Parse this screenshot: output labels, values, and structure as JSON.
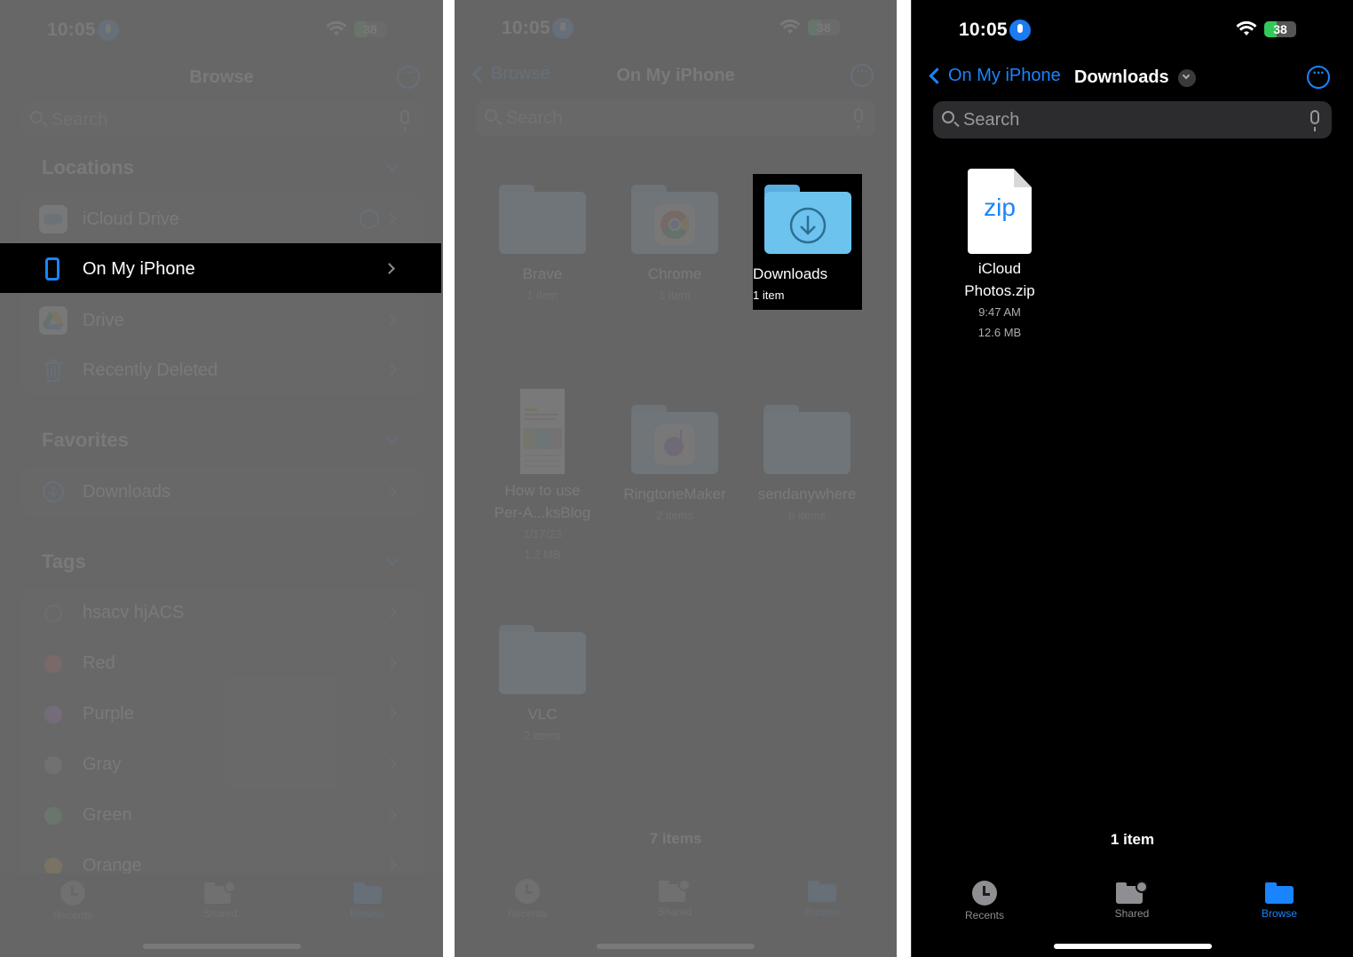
{
  "status_bar": {
    "time": "10:05",
    "battery_percent": "38",
    "battery_level": 0.38,
    "charging": true
  },
  "panel_browse": {
    "title": "Browse",
    "search_placeholder": "Search",
    "sections": {
      "locations": {
        "title": "Locations",
        "items": [
          {
            "label": "iCloud Drive",
            "icon": "icloud-icon",
            "loading": true
          },
          {
            "label": "On My iPhone",
            "icon": "iphone-icon",
            "selected": true
          },
          {
            "label": "Drive",
            "icon": "google-drive-icon"
          },
          {
            "label": "Recently Deleted",
            "icon": "trash-icon"
          }
        ]
      },
      "favorites": {
        "title": "Favorites",
        "items": [
          {
            "label": "Downloads",
            "icon": "download-circle-icon"
          }
        ]
      },
      "tags": {
        "title": "Tags",
        "items": [
          {
            "label": "hsacv hjACS",
            "color": "none"
          },
          {
            "label": "Red",
            "color": "#ff453a"
          },
          {
            "label": "Purple",
            "color": "#bf5af2"
          },
          {
            "label": "Gray",
            "color": "#98989d"
          },
          {
            "label": "Green",
            "color": "#30d158"
          },
          {
            "label": "Orange",
            "color": "#ff9f0a"
          }
        ]
      }
    }
  },
  "panel_on_my_iphone": {
    "back_label": "Browse",
    "title": "On My iPhone",
    "search_placeholder": "Search",
    "items": [
      {
        "name": "Brave",
        "sub": "1 item",
        "type": "folder"
      },
      {
        "name": "Chrome",
        "sub": "1 item",
        "type": "folder",
        "badge": "chrome-icon"
      },
      {
        "name": "Downloads",
        "sub": "1 item",
        "type": "folder",
        "badge": "download-circle-icon",
        "selected": true
      },
      {
        "name": "How to use Per-A...ksBlog",
        "name_line1": "How to use",
        "name_line2": "Per-A...ksBlog",
        "date": "1/17/23",
        "size": "1.2 MB",
        "type": "document"
      },
      {
        "name": "RingtoneMaker",
        "sub": "2 items",
        "type": "folder",
        "badge": "ringtone-icon"
      },
      {
        "name": "sendanywhere",
        "sub": "6 items",
        "type": "folder"
      },
      {
        "name": "VLC",
        "sub": "2 items",
        "type": "folder"
      }
    ],
    "item_count": "7 items"
  },
  "panel_downloads": {
    "back_label": "On My iPhone",
    "title": "Downloads",
    "search_placeholder": "Search",
    "items": [
      {
        "name_line1": "iCloud",
        "name_line2": "Photos.zip",
        "badge_text": "zip",
        "time": "9:47 AM",
        "size": "12.6 MB"
      }
    ],
    "item_count": "1 item"
  },
  "tab_bar": {
    "tabs": [
      {
        "label": "Recents",
        "icon": "clock-icon"
      },
      {
        "label": "Shared",
        "icon": "shared-folder-icon"
      },
      {
        "label": "Browse",
        "icon": "folder-icon",
        "active": true
      }
    ]
  },
  "colors": {
    "accent": "#1a84ff",
    "background": "#000000",
    "dim_overlay": "#6e6e6e"
  }
}
